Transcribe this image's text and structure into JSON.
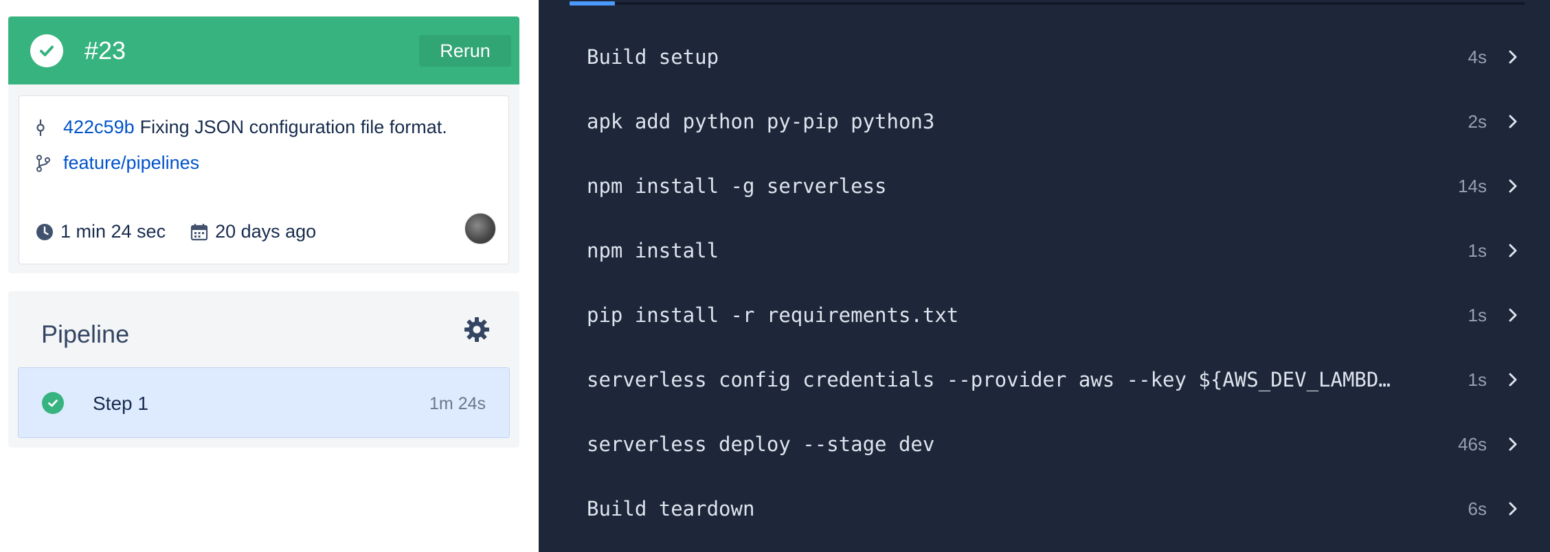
{
  "build": {
    "number": "#23",
    "rerun_label": "Rerun",
    "status_color": "#36b37e"
  },
  "commit": {
    "hash": "422c59b",
    "message": "Fixing JSON configuration file format.",
    "branch": "feature/pipelines",
    "duration": "1 min 24 sec",
    "date": "20 days ago"
  },
  "pipeline": {
    "title": "Pipeline",
    "steps": [
      {
        "label": "Step 1",
        "time": "1m 24s"
      }
    ]
  },
  "log": {
    "rows": [
      {
        "cmd": "Build setup",
        "duration": "4s"
      },
      {
        "cmd": "apk add python py-pip python3",
        "duration": "2s"
      },
      {
        "cmd": "npm install -g serverless",
        "duration": "14s"
      },
      {
        "cmd": "npm install",
        "duration": "1s"
      },
      {
        "cmd": "pip install -r requirements.txt",
        "duration": "1s"
      },
      {
        "cmd": "serverless config credentials --provider aws --key ${AWS_DEV_LAMBDA_K…",
        "duration": "1s"
      },
      {
        "cmd": "serverless deploy --stage dev",
        "duration": "46s"
      },
      {
        "cmd": "Build teardown",
        "duration": "6s"
      }
    ]
  },
  "colors": {
    "success": "#36b37e",
    "link": "#0052cc",
    "log_bg": "#1d2739",
    "step_selected": "#deebff"
  },
  "icons": [
    "check-icon",
    "commit-icon",
    "branch-icon",
    "clock-icon",
    "calendar-icon",
    "gear-icon",
    "chevron-right-icon"
  ]
}
